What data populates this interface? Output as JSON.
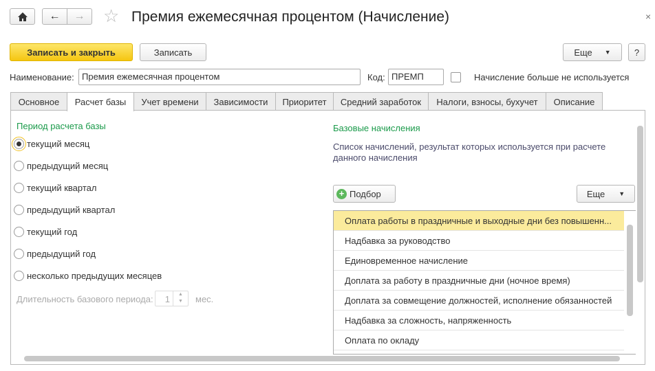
{
  "header": {
    "title": "Премия ежемесячная процентом (Начисление)",
    "close": "×"
  },
  "toolbar": {
    "save_close": "Записать и закрыть",
    "save": "Записать",
    "more": "Еще",
    "help": "?"
  },
  "fields": {
    "name_label": "Наименование:",
    "name_value": "Премия ежемесячная процентом",
    "code_label": "Код:",
    "code_value": "ПРЕМП",
    "unused_label": "Начисление больше не используется",
    "unused_checked": false
  },
  "tabs": [
    {
      "label": "Основное"
    },
    {
      "label": "Расчет базы",
      "active": true
    },
    {
      "label": "Учет времени"
    },
    {
      "label": "Зависимости"
    },
    {
      "label": "Приоритет"
    },
    {
      "label": "Средний заработок"
    },
    {
      "label": "Налоги, взносы, бухучет"
    },
    {
      "label": "Описание"
    }
  ],
  "period": {
    "title": "Период расчета базы",
    "options": [
      "текущий месяц",
      "предыдущий месяц",
      "текущий квартал",
      "предыдущий квартал",
      "текущий год",
      "предыдущий год",
      "несколько предыдущих месяцев"
    ],
    "selected": "текущий месяц",
    "duration_label": "Длительность базового периода:",
    "duration_value": "1",
    "duration_unit": "мес."
  },
  "base": {
    "title": "Базовые начисления",
    "description": "Список начислений, результат которых используется при расчете данного начисления",
    "pick": "Подбор",
    "more": "Еще",
    "items": [
      "Оплата работы в праздничные и выходные дни без повышенн...",
      "Надбавка за руководство",
      "Единовременное начисление",
      "Доплата за работу в праздничные дни (ночное время)",
      "Доплата за совмещение должностей, исполнение обязанностей",
      "Надбавка за сложность, напряженность",
      "Оплата по окладу"
    ]
  },
  "colors": {
    "accent": "#f5c611",
    "section_title": "#1a9a4a",
    "selected_row": "#fbeb9c"
  }
}
